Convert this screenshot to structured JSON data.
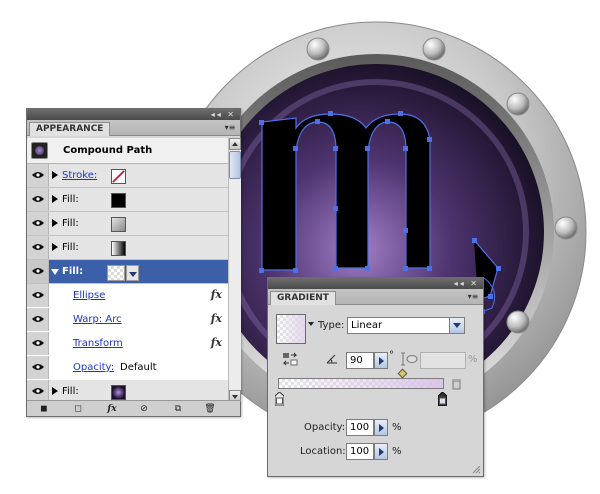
{
  "appearance": {
    "tab_label": "APPEARANCE",
    "header": {
      "title": "Compound Path"
    },
    "rows": [
      {
        "kind": "stroke",
        "label": "Stroke:",
        "swatch": "none"
      },
      {
        "kind": "fill",
        "label": "Fill:",
        "swatch": "#000000"
      },
      {
        "kind": "fill",
        "label": "Fill:",
        "swatch": "#bcbcbc"
      },
      {
        "kind": "fill",
        "label": "Fill:",
        "swatch": "gradient-dark"
      },
      {
        "kind": "fill-selected",
        "label": "Fill:",
        "swatch": "transparent-gradient"
      },
      {
        "kind": "effect",
        "label": "Ellipse",
        "fx": "fx"
      },
      {
        "kind": "effect",
        "label": "Warp: Arc",
        "fx": "fx"
      },
      {
        "kind": "effect",
        "label": "Transform",
        "fx": "fx"
      },
      {
        "kind": "opacity",
        "label": "Opacity:",
        "value": "Default"
      },
      {
        "kind": "fill",
        "label": "Fill:",
        "swatch": "radial-purple"
      }
    ],
    "footer_fx": "fx"
  },
  "gradient": {
    "tab_label": "GRADIENT",
    "type_label": "Type:",
    "type_value": "Linear",
    "angle_value": "90",
    "angle_unit": "°",
    "aspect_unit": "%",
    "opacity_label": "Opacity:",
    "opacity_value": "100",
    "opacity_unit": "%",
    "location_label": "Location:",
    "location_value": "100",
    "location_unit": "%"
  },
  "colors": {
    "panel_bg": "#d6d6d6",
    "selection": "#3b5fa8",
    "link": "#1a35c9",
    "ring_metal": "#bdbdbd",
    "inner_purple": "#6a4d8f",
    "path_outline": "#4f6fe6"
  }
}
